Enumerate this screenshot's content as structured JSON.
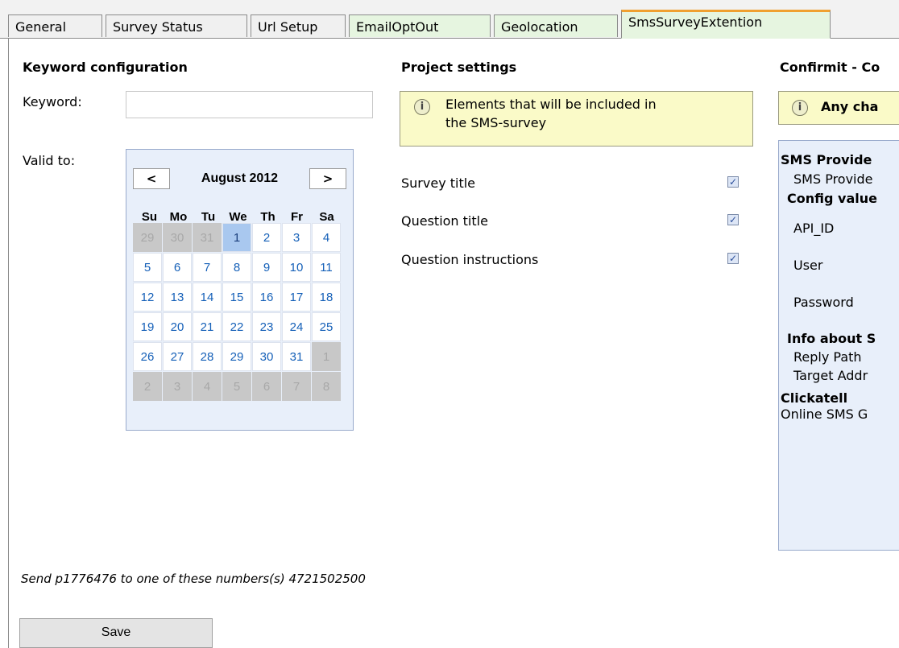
{
  "tabs": [
    {
      "label": "General"
    },
    {
      "label": "Survey Status"
    },
    {
      "label": "Url Setup"
    },
    {
      "label": "EmailOptOut"
    },
    {
      "label": "Geolocation"
    },
    {
      "label": "SmsSurveyExtention"
    }
  ],
  "keyword_section": {
    "heading": "Keyword configuration",
    "keyword_label": "Keyword:",
    "keyword_value": "",
    "valid_to_label": "Valid to:"
  },
  "calendar": {
    "prev": "<",
    "next": ">",
    "month_label": "August 2012",
    "weekdays": [
      "Su",
      "Mo",
      "Tu",
      "We",
      "Th",
      "Fr",
      "Sa"
    ],
    "days": [
      [
        "29",
        "30",
        "31",
        "1",
        "2",
        "3",
        "4"
      ],
      [
        "5",
        "6",
        "7",
        "8",
        "9",
        "10",
        "11"
      ],
      [
        "12",
        "13",
        "14",
        "15",
        "16",
        "17",
        "18"
      ],
      [
        "19",
        "20",
        "21",
        "22",
        "23",
        "24",
        "25"
      ],
      [
        "26",
        "27",
        "28",
        "29",
        "30",
        "31",
        "1"
      ],
      [
        "2",
        "3",
        "4",
        "5",
        "6",
        "7",
        "8"
      ]
    ],
    "selected_day": "1"
  },
  "project_settings": {
    "heading": "Project settings",
    "info_text_line1": "Elements that will be included in",
    "info_text_line2": "the SMS-survey",
    "options": [
      {
        "label": "Survey title",
        "checked": true
      },
      {
        "label": "Question title",
        "checked": true
      },
      {
        "label": "Question instructions",
        "checked": true
      }
    ]
  },
  "confirmit": {
    "heading": "Confirmit - Co",
    "info_text": "Any cha",
    "sms_provider_heading": "SMS Provide",
    "sms_provider_label": "SMS Provide",
    "config_values_heading": "Config value",
    "fields": [
      "API_ID",
      "User",
      "Password"
    ],
    "info_about_heading": "Info about S",
    "reply_path": "Reply Path",
    "target_addr": "Target Addr",
    "provider_name": "Clickatell",
    "provider_desc": "Online SMS G"
  },
  "send_note": "Send p1776476 to one of these numbers(s) 4721502500",
  "save_label": "Save",
  "colors": {
    "tab_green": "#e6f5e0",
    "active_tab_top": "#f0a030",
    "info_bg": "#fafac8",
    "calendar_bg": "#e8effa",
    "link_blue": "#1560b8"
  }
}
